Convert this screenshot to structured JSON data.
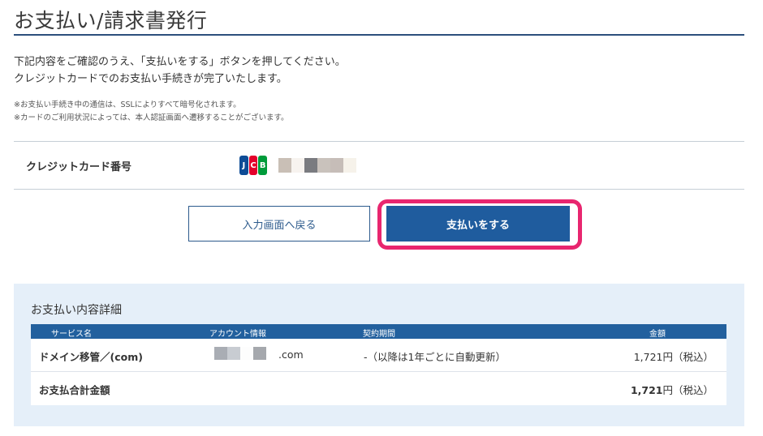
{
  "page": {
    "title": "お支払い/請求書発行",
    "intro_line1": "下記内容をご確認のうえ、「支払いをする」ボタンを押してください。",
    "intro_line2": "クレジットカードでのお支払い手続きが完了いたします。",
    "note1": "※お支払い手続き中の通信は、SSLによりすべて暗号化されます。",
    "note2": "※カードのご利用状況によっては、本人認証画面へ遷移することがございます。"
  },
  "card": {
    "label": "クレジットカード番号",
    "brand_icon": "jcb-logo-icon",
    "brand_letters": [
      "J",
      "C",
      "B"
    ]
  },
  "buttons": {
    "back_label": "入力画面へ戻る",
    "pay_label": "支払いをする"
  },
  "details": {
    "title": "お支払い内容詳細",
    "columns": [
      "サービス名",
      "アカウント情報",
      "契約期間",
      "金額"
    ],
    "rows": [
      {
        "service": "ドメイン移管／(com)",
        "account_suffix": ".com",
        "period": "-（以降は1年ごとに自動更新）",
        "amount": "1,721円（税込）"
      }
    ],
    "total_label": "お支払合計金額",
    "total_amount_num": "1,721",
    "total_amount_unit": "円（税込）"
  },
  "colors": {
    "accent": "#1f5c9e",
    "highlight": "#e8266f",
    "panel": "#e5eff9"
  }
}
